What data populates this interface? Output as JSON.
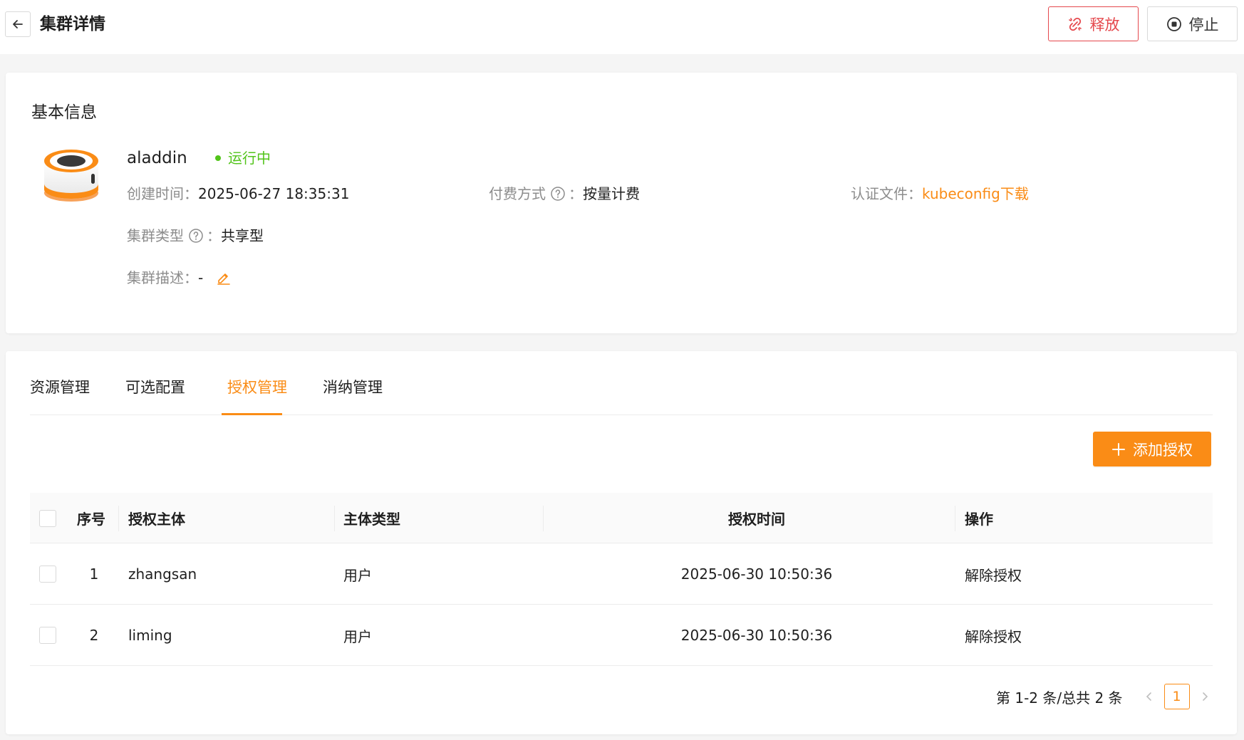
{
  "header": {
    "title": "集群详情",
    "release_label": "释放",
    "stop_label": "停止"
  },
  "basic_info": {
    "section_title": "基本信息",
    "cluster_name": "aladdin",
    "status": "运行中",
    "created_label": "创建时间：",
    "created_value": "2025-06-27 18:35:31",
    "billing_label": "付费方式",
    "billing_colon": "：",
    "billing_value": "按量计费",
    "auth_label": "认证文件：",
    "auth_link": "kubeconfig下载",
    "type_label": "集群类型",
    "type_colon": "：",
    "type_value": "共享型",
    "desc_label": "集群描述：",
    "desc_value": "-"
  },
  "tabs": [
    "资源管理",
    "可选配置",
    "授权管理",
    "消纳管理"
  ],
  "active_tab": "授权管理",
  "add_button_label": "添加授权",
  "table": {
    "columns": [
      "序号",
      "授权主体",
      "主体类型",
      "授权时间",
      "操作"
    ],
    "rows": [
      {
        "index": "1",
        "subject": "zhangsan",
        "type": "用户",
        "time": "2025-06-30 10:50:36",
        "action": "解除授权"
      },
      {
        "index": "2",
        "subject": "liming",
        "type": "用户",
        "time": "2025-06-30 10:50:36",
        "action": "解除授权"
      }
    ]
  },
  "pagination": {
    "total_text": "第 1-2 条/总共 2 条",
    "current_page": "1"
  },
  "colors": {
    "accent": "#fa8c16",
    "danger": "#e5484d",
    "success": "#52c41a"
  },
  "icons": {
    "back": "arrow-left-icon",
    "release": "unlink-icon",
    "stop": "stop-circle-icon",
    "help": "question-circle-icon",
    "edit": "edit-icon",
    "add": "plus-icon",
    "logo": "cluster-cylinder-icon"
  }
}
